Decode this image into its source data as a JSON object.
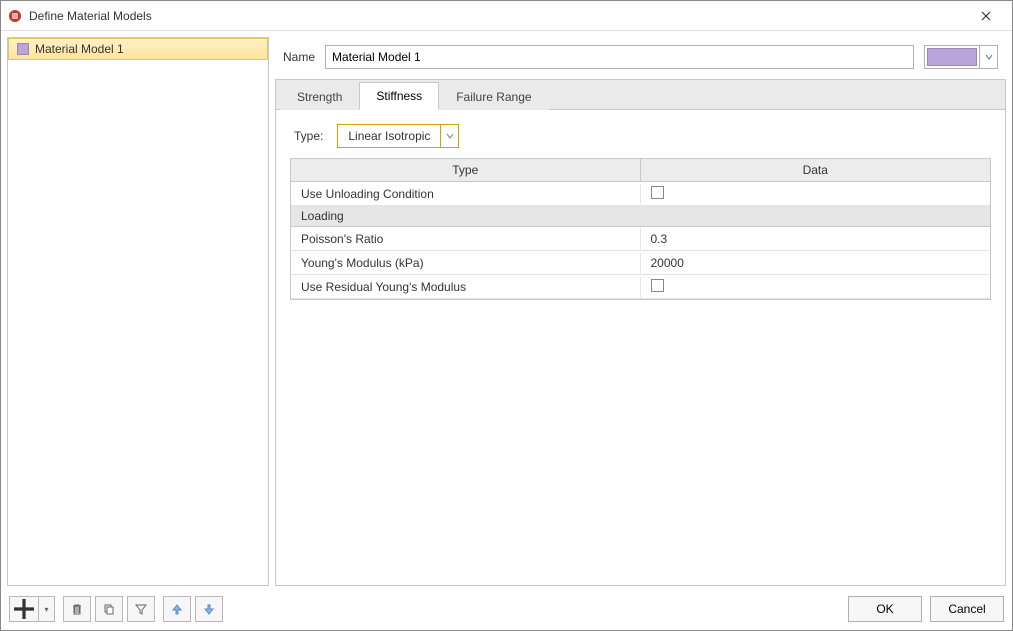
{
  "window": {
    "title": "Define Material Models"
  },
  "sidebar": {
    "items": [
      {
        "label": "Material Model 1",
        "color": "#b9a5d8"
      }
    ]
  },
  "form": {
    "name_label": "Name",
    "name_value": "Material Model 1",
    "color": "#b9a5d8"
  },
  "tabs": [
    {
      "id": "strength",
      "label": "Strength"
    },
    {
      "id": "stiffness",
      "label": "Stiffness"
    },
    {
      "id": "failure",
      "label": "Failure Range"
    }
  ],
  "active_tab": "stiffness",
  "stiffness": {
    "type_label": "Type:",
    "type_value": "Linear Isotropic",
    "table": {
      "headers": {
        "type": "Type",
        "data": "Data"
      },
      "rows": [
        {
          "kind": "row",
          "label": "Use Unloading Condition",
          "value_type": "checkbox",
          "value": false,
          "indent": false
        },
        {
          "kind": "group",
          "label": "Loading"
        },
        {
          "kind": "row",
          "label": "Poisson's Ratio",
          "value_type": "text",
          "value": "0.3",
          "indent": true
        },
        {
          "kind": "row",
          "label": "Young's Modulus (kPa)",
          "value_type": "text",
          "value": "20000",
          "indent": true
        },
        {
          "kind": "row",
          "label": "Use Residual Young's Modulus",
          "value_type": "checkbox",
          "value": false,
          "indent": true
        }
      ]
    }
  },
  "toolbar": {
    "add": "add",
    "delete": "delete",
    "copy": "copy",
    "filter": "filter",
    "up": "up",
    "down": "down"
  },
  "buttons": {
    "ok": "OK",
    "cancel": "Cancel"
  }
}
